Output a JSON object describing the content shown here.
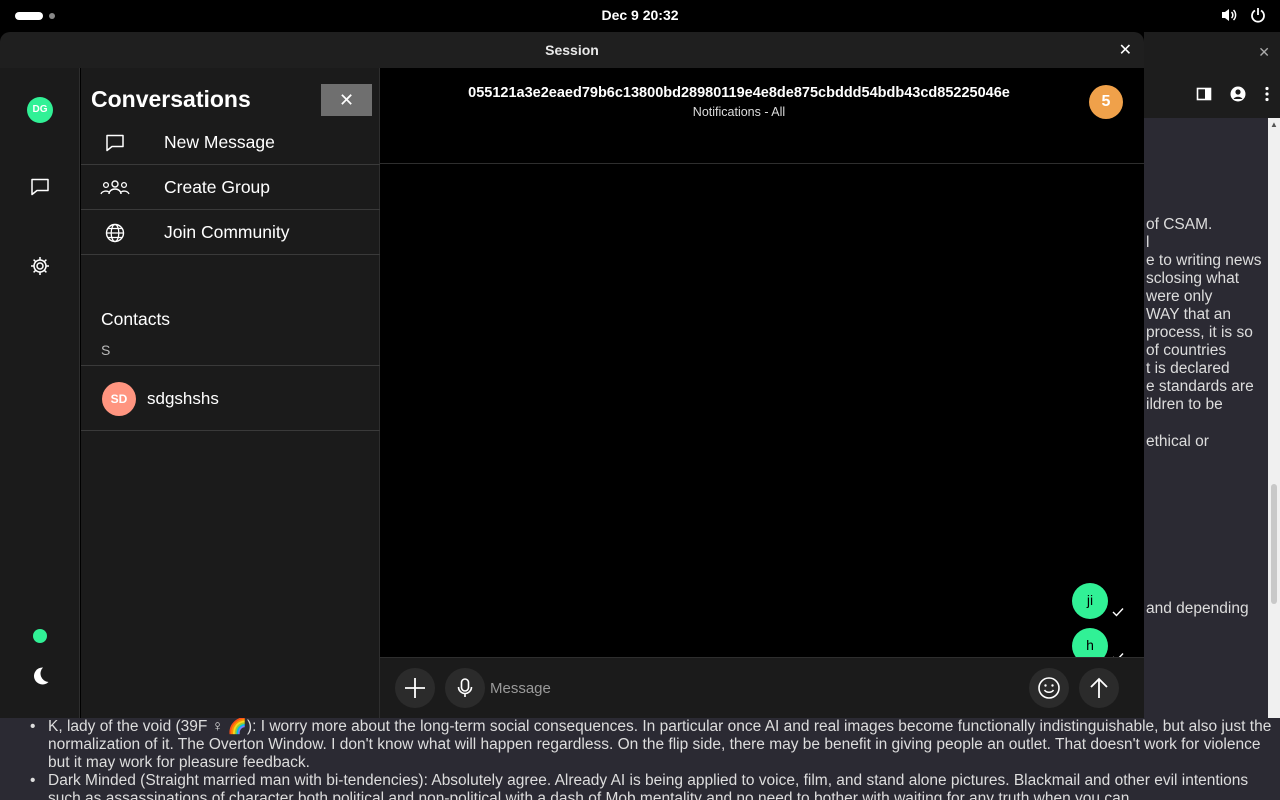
{
  "topbar": {
    "clock": "Dec 9  20:32",
    "icons": [
      "volume-icon",
      "power-icon"
    ]
  },
  "window": {
    "title": "Session"
  },
  "rail": {
    "avatar_initials": "DG",
    "items": [
      "messages-icon",
      "settings-icon",
      "moon-icon"
    ],
    "colors": {
      "accent": "#31f196"
    }
  },
  "conversations": {
    "title": "Conversations",
    "close_label": "✕",
    "menu": [
      {
        "label": "New Message",
        "icon": "message-icon"
      },
      {
        "label": "Create Group",
        "icon": "group-icon"
      },
      {
        "label": "Join Community",
        "icon": "globe-icon"
      }
    ],
    "contacts_heading": "Contacts",
    "contacts_letter": "S",
    "contacts": [
      {
        "initials": "SD",
        "name": "sdgshshs",
        "avatar_color": "#ff9580"
      }
    ]
  },
  "chat": {
    "session_id": "055121a3e2eaed79b6c13800bd28980119e4e8de875cbddd54bdb43cd85225046e",
    "subtitle": "Notifications - All",
    "badge_count": "5",
    "messages": [
      {
        "text": "ji",
        "status": "sent"
      },
      {
        "text": "h",
        "status": "sent"
      }
    ],
    "composer": {
      "placeholder": "Message"
    }
  },
  "background_page": {
    "right_lines": [
      "of CSAM.",
      "l",
      "e to writing news",
      "sclosing what",
      "were only",
      "WAY that an",
      "process, it is so",
      "of countries",
      "t is declared",
      "e standards are",
      "ildren to be",
      "ethical or",
      "and depending"
    ],
    "bottom_items": [
      "K, lady of the void (39F ♀ 🌈): I worry more about the long-term social consequences. In particular once AI and real images become functionally indistinguishable, but also just the normalization of it. The Overton Window. I don't know what will happen regardless. On the flip side, there may be benefit in giving people an outlet. That doesn't work for violence but it may work for pleasure feedback.",
      "Dark Minded (Straight married man with bi-tendencies): Absolutely agree. Already AI is being applied to voice, film, and stand alone pictures. Blackmail and other evil intentions such as assassinations of character both political and non-political with a dash of Mob mentality and no need to bother with waiting for any truth when you can"
    ]
  }
}
